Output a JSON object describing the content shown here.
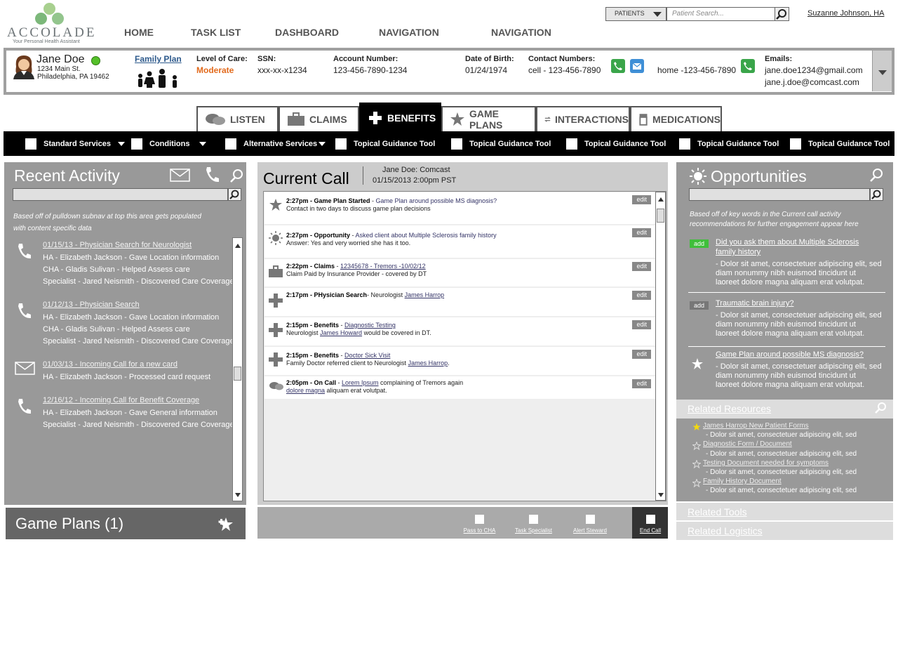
{
  "brand": {
    "name": "ACCOLADE",
    "tagline": "Your Personal Health Assistant"
  },
  "nav": [
    "HOME",
    "TASK LIST",
    "DASHBOARD",
    "NAVIGATION",
    "NAVIGATION"
  ],
  "search": {
    "type": "PATIENTS",
    "placeholder": "Patient Search..."
  },
  "user": "Suzanne Johnson, HA",
  "patient": {
    "name": "Jane Doe",
    "addr1": "1234 Main St.",
    "addr2": "Philadelphia, PA 19462",
    "family_label": "Family Plan",
    "care_label": "Level of Care:",
    "care_value": "Moderate",
    "ssn_label": "SSN:",
    "ssn_value": "xxx-xx-x1234",
    "acct_label": "Account Number:",
    "acct_value": "123-456-7890-1234",
    "dob_label": "Date of Birth:",
    "dob_value": "01/24/1974",
    "contact_label": "Contact Numbers:",
    "cell": "cell - 123-456-7890",
    "home": "home -123-456-7890",
    "email_label": "Emails:",
    "email1": "jane.doe1234@gmail.com",
    "email2": "jane.j.doe@comcast.com"
  },
  "tabs": [
    "LISTEN",
    "CLAIMS",
    "BENEFITS",
    "GAME PLANS",
    "INTERACTIONS",
    "MEDICATIONS"
  ],
  "subnav": [
    "Standard Services",
    "Conditions",
    "Alternative Services",
    "Topical Guidance Tool",
    "Topical Guidance Tool",
    "Topical Guidance Tool",
    "Topical Guidance Tool",
    "Topical Guidance Tool"
  ],
  "recent": {
    "title": "Recent Activity",
    "note1": "Based off of pulldown subnav at top this area gets populated",
    "note2": "with content specific data",
    "items": [
      {
        "title": "01/15/13 - Physician Search for Neurologist",
        "lines": [
          "HA - Elizabeth Jackson - Gave Location information",
          "CHA - Gladis Sulivan - Helped Assess care",
          "Specialist - Jared Neismith - Discovered Care Coverage"
        ]
      },
      {
        "title": "01/12/13 - Physician Search ",
        "lines": [
          "HA - Elizabeth Jackson - Gave Location information",
          "CHA - Gladis Sulivan - Helped Assess care",
          "Specialist - Jared Neismith - Discovered Care Coverage"
        ]
      },
      {
        "title": "01/03/13 - Incoming Call for a new card",
        "lines": [
          "HA - Elizabeth Jackson - Processed card  request"
        ]
      },
      {
        "title": "12/16/12 - Incoming Call for Benefit Coverage",
        "lines": [
          "HA - Elizabeth Jackson - Gave General information",
          "Specialist - Jared Neismith - Discovered Care Coverage"
        ]
      }
    ]
  },
  "gameplans": {
    "title": "Game Plans  (1)"
  },
  "call": {
    "title": "Current Call",
    "who": "Jane Doe: Comcast",
    "when": "01/15/2013  2:00pm PST",
    "edit": "edit",
    "entries": [
      {
        "head": "2:27pm - Game Plan Started",
        "sep": " - ",
        "link": "Game Plan around possible MS diagnosis?",
        "line2": "Contact in two days to discuss game plan decisions"
      },
      {
        "head": "2:27pm - Opportunity",
        "sep": " - ",
        "link": "Asked client about Multiple Sclerosis family history",
        "line2": "Answer: Yes and very worried she has it too."
      },
      {
        "head": "2:22pm - Claims",
        "sep": " - ",
        "link": "12345678 - Tremors -10/02/12",
        "line2": "Claim Paid by Insurance Provider - covered by DT"
      },
      {
        "head": "2:17pm - PHysician Search",
        "sep": "- Neurologist ",
        "link": "James Harrop",
        "line2": ""
      },
      {
        "head": "2:15pm - Benefits",
        "sep": " - ",
        "link": "Diagnostic Testing",
        "line2a": "Neurologist ",
        "line2link": "James Howard",
        "line2b": " would be covered in DT."
      },
      {
        "head": "2:15pm - Benefits",
        "sep": " - ",
        "link": "Doctor Sick Visit",
        "line2a": "Family Doctor referred client to Neurologist ",
        "line2link": "James Harrop",
        "line2b": "."
      },
      {
        "head": "2:05pm - On Call",
        "sep": " - ",
        "link": "Lorem Ipsum",
        "tail": " complaining of Tremors again",
        "line2link": "dolore magna",
        "line2b": " aliquam erat volutpat."
      }
    ],
    "actions": [
      "Pass to CHA",
      "Task Specialist",
      "Alert Steward",
      "End Call"
    ]
  },
  "opp": {
    "title": "Opportunities",
    "note1": "Based off of key words in the Current call activity",
    "note2": "recommendations for further engagement appear here",
    "add": "add",
    "items": [
      {
        "t1": "Did you ask them about Multiple Sclerosis",
        "t2": "family history",
        "d": [
          "- Dolor sit amet, consectetuer adipiscing elit, sed",
          "diam nonummy nibh euismod tincidunt ut",
          "laoreet dolore magna aliquam erat volutpat."
        ]
      },
      {
        "t1": " Traumatic brain injury? ",
        "t2": "",
        "d": [
          "- Dolor sit amet, consectetuer adipiscing elit, sed",
          "diam nonummy nibh euismod tincidunt ut",
          "laoreet dolore magna aliquam erat volutpat."
        ]
      },
      {
        "t1": "Game Plan around possible MS diagnosis?",
        "t2": "",
        "d": [
          "- Dolor sit amet, consectetuer adipiscing elit, sed",
          "diam nonummy nibh euismod tincidunt ut",
          "laoreet dolore magna aliquam erat volutpat."
        ]
      }
    ]
  },
  "resources": {
    "title": "Related Resources",
    "items": [
      {
        "t": "James Harrop New Patient Forms",
        "d": "- Dolor sit amet, consectetuer adipiscing elit, sed"
      },
      {
        "t": "Diagnostic Form / Document ",
        "d": "- Dolor sit amet, consectetuer adipiscing elit, sed"
      },
      {
        "t": "Testing Document needed for symptoms ",
        "d": "- Dolor sit amet, consectetuer adipiscing elit, sed"
      },
      {
        "t": "Family History Document",
        "d": "- Dolor sit amet, consectetuer adipiscing elit, sed"
      }
    ]
  },
  "tools": "Related Tools",
  "logistics": "Related Logistics"
}
